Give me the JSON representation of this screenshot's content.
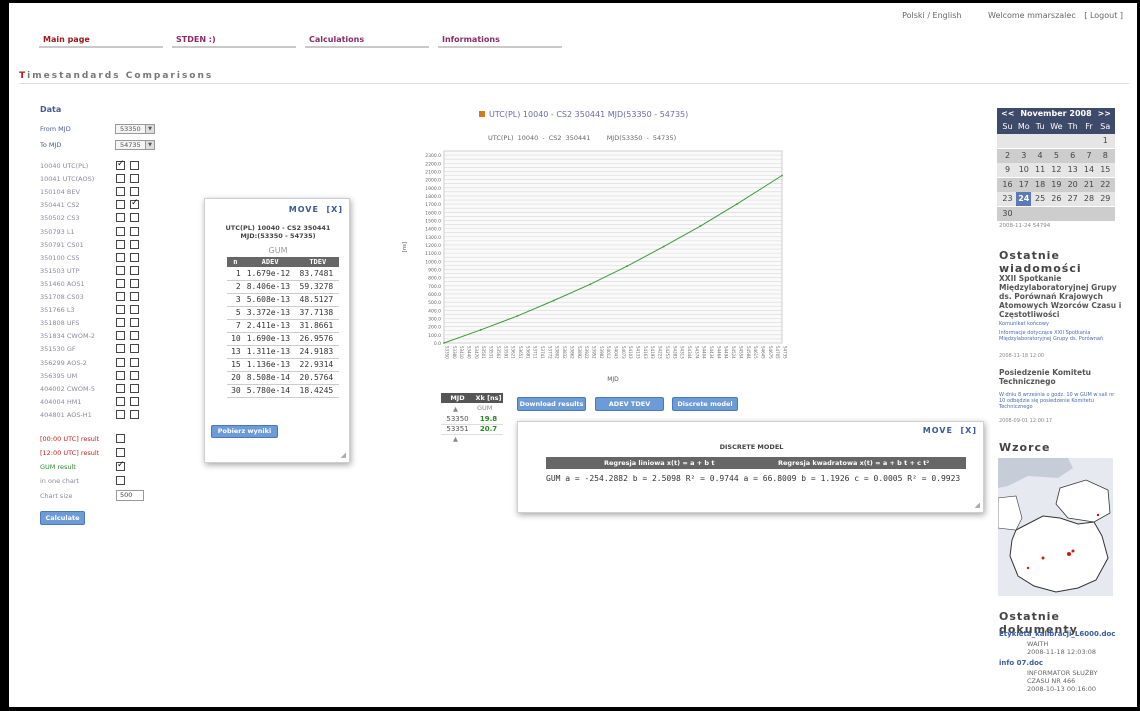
{
  "header": {
    "lang": "Polski / English",
    "welcome": "Welcome mmarszalec",
    "logout": "[ Logout ]"
  },
  "nav": [
    "Main page",
    "STDEN :)",
    "Calculations",
    "Informations"
  ],
  "page_title_first": "T",
  "page_title_rest": "imestandards Comparisons",
  "data_panel": {
    "heading": "Data",
    "from_label": "From MJD",
    "from_value": "53350",
    "to_label": "To MJD",
    "to_value": "54735",
    "clocks": [
      {
        "label": "10040 UTC(PL)",
        "c1": true,
        "c2": false
      },
      {
        "label": "10041 UTC(AOS)",
        "c1": false,
        "c2": false
      },
      {
        "label": "150104 BEV",
        "c1": false,
        "c2": false
      },
      {
        "label": "350441 CS2",
        "c1": false,
        "c2": true
      },
      {
        "label": "350502 CS3",
        "c1": false,
        "c2": false
      },
      {
        "label": "350793 L1",
        "c1": false,
        "c2": false
      },
      {
        "label": "350791 CS01",
        "c1": false,
        "c2": false
      },
      {
        "label": "350100 CS5",
        "c1": false,
        "c2": false
      },
      {
        "label": "351503 UTP",
        "c1": false,
        "c2": false
      },
      {
        "label": "351460 AOS1",
        "c1": false,
        "c2": false
      },
      {
        "label": "351708 CS03",
        "c1": false,
        "c2": false
      },
      {
        "label": "351766 L3",
        "c1": false,
        "c2": false
      },
      {
        "label": "351808 UFS",
        "c1": false,
        "c2": false
      },
      {
        "label": "351834 CWOM-2",
        "c1": false,
        "c2": false
      },
      {
        "label": "351530 GF",
        "c1": false,
        "c2": false
      },
      {
        "label": "356299 AOS-2",
        "c1": false,
        "c2": false
      },
      {
        "label": "356395 UM",
        "c1": false,
        "c2": false
      },
      {
        "label": "404002 CWOM-5",
        "c1": false,
        "c2": false
      },
      {
        "label": "404004 HM1",
        "c1": false,
        "c2": false
      },
      {
        "label": "404801 AOS-H1",
        "c1": false,
        "c2": false
      }
    ],
    "opt1": "[00:00 UTC] result",
    "opt2": "[12:00 UTC] result",
    "opt3": "GUM result",
    "opt4": "in one chart",
    "chart_size_label": "Chart size",
    "chart_size_value": "500",
    "calculate": "Calculate"
  },
  "gum_popup": {
    "move": "MOVE",
    "close": "[X]",
    "title1": "UTC(PL) 10040 - CS2 350441",
    "title2": "MJD:(53350 - 54735)",
    "gum_label": "GUM",
    "headers": [
      "n",
      "ADEV",
      "TDEV"
    ],
    "rows": [
      [
        "1",
        "1.679e-12",
        "83.7481"
      ],
      [
        "2",
        "8.406e-13",
        "59.3278"
      ],
      [
        "3",
        "5.608e-13",
        "48.5127"
      ],
      [
        "5",
        "3.372e-13",
        "37.7138"
      ],
      [
        "7",
        "2.411e-13",
        "31.8661"
      ],
      [
        "10",
        "1.690e-13",
        "26.9576"
      ],
      [
        "13",
        "1.311e-13",
        "24.9183"
      ],
      [
        "15",
        "1.136e-13",
        "22.9314"
      ],
      [
        "20",
        "8.508e-14",
        "20.5764"
      ],
      [
        "30",
        "5.780e-14",
        "18.4245"
      ]
    ],
    "button": "Pobierz wyniki"
  },
  "chart_title": "UTC(PL) 10040 - CS2 350441 MJD(53350 - 54735)",
  "chart_legend": [
    "UTC(PL) 10040",
    "CS2 350441",
    "MJD(53350 - 54735)"
  ],
  "chart_data": {
    "type": "line",
    "title": "UTC(PL) 10040 - CS2 350441 MJD(53350 - 54735)",
    "xlabel": "MJD",
    "ylabel": "[ns]",
    "x": [
      53350,
      53500,
      53650,
      53800,
      53950,
      54100,
      54250,
      54400,
      54550,
      54735
    ],
    "series": [
      {
        "color": "#3a9a3a",
        "values": [
          0,
          160,
          330,
          520,
          720,
          940,
          1180,
          1430,
          1700,
          2050
        ]
      }
    ],
    "ylim": [
      0,
      2350
    ],
    "grid": true
  },
  "mjd_table": {
    "headers": [
      "MJD",
      "Xk [ns]"
    ],
    "sub": "GUM",
    "rows": [
      [
        "53350",
        "19.8"
      ],
      [
        "53351",
        "20.7"
      ]
    ]
  },
  "action_buttons": [
    "Download results",
    "ADEV TDEV",
    "Discrete model"
  ],
  "discrete_popup": {
    "move": "MOVE",
    "close": "[X]",
    "title": "DISCRETE MODEL",
    "col1": "Regresja liniowa x(t) = a + b t",
    "col2": "Regresja kwadratowa x(t) = a + b t + c t²",
    "row_label": "GUM",
    "lin": "a = -254.2882  b = 2.5098  R² = 0.9744",
    "quad": "a = 66.8009  b = 1.1926  c = 0.0005  R² = 0.9923"
  },
  "calendar": {
    "prev": "<<",
    "next": ">>",
    "month": "November 2008",
    "dows": [
      "Su",
      "Mo",
      "Tu",
      "We",
      "Th",
      "Fr",
      "Sa"
    ],
    "weeks": [
      [
        "",
        "",
        "",
        "",
        "",
        "",
        "1"
      ],
      [
        "2",
        "3",
        "4",
        "5",
        "6",
        "7",
        "8"
      ],
      [
        "9",
        "10",
        "11",
        "12",
        "13",
        "14",
        "15"
      ],
      [
        "16",
        "17",
        "18",
        "19",
        "20",
        "21",
        "22"
      ],
      [
        "23",
        "24",
        "25",
        "26",
        "27",
        "28",
        "29"
      ],
      [
        "30",
        "",
        "",
        "",
        "",
        "",
        ""
      ]
    ],
    "selected": "24",
    "caption": "2008-11-24 54794"
  },
  "sidebar": {
    "news_heading": "Ostatnie wiadomości",
    "news1_title": "XXII Spotkanie Międzylaboratoryjnej Grupy ds. Porównań Krajowych Atomowych Wzorców Czasu i Częstotliwości",
    "news1_link": "Komunikat końcowy",
    "news1_text": "Informacje dotyczące XXII Spotkania Międzylaboratoryjnej Grupy ds. Porównań",
    "news1_date": "2008-11-18 12:00",
    "news2_title": "Posiedzenie Komitetu Technicznego",
    "news2_text": "W dniu 8 września o godz. 10 w GUM w sali nr 10 odbędzie się posiedzenie Komitetu Technicznego",
    "news2_date": "2008-09-01 12:00:17",
    "wzorce_heading": "Wzorce",
    "docs_heading": "Ostatnie dokumenty",
    "doc1_link": "Etykieta_kalibracji_L6000.doc",
    "doc1_meta1": "WAITH",
    "doc1_meta2": "2008-11-18 12:03:08",
    "doc2_link": "info 07.doc",
    "doc2_meta1": "INFORMATOR SŁUŻBY",
    "doc2_meta2": "CZASU NR 466",
    "doc2_meta3": "2008-10-13 00:16:00"
  }
}
